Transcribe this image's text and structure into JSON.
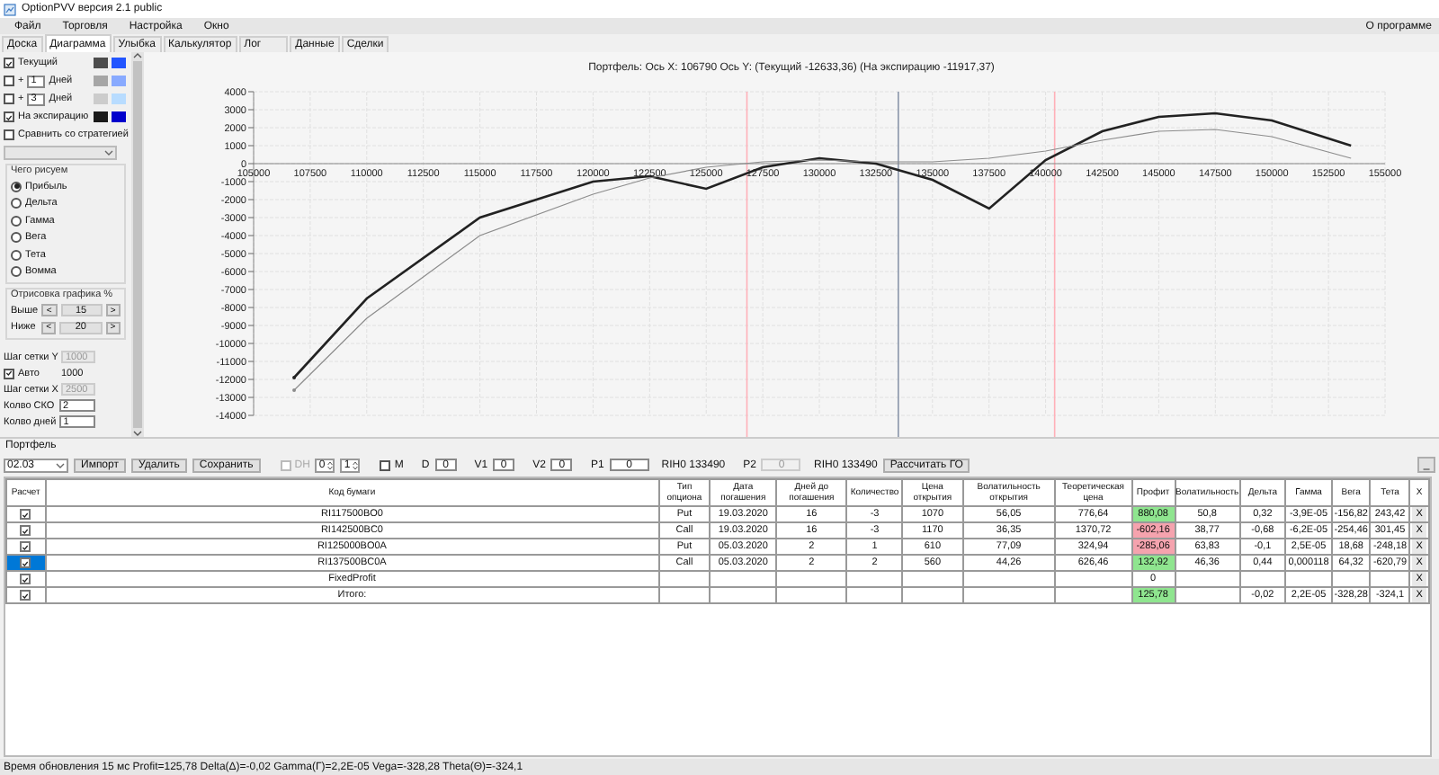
{
  "window": {
    "title": "OptionPVV версия 2.1 public"
  },
  "menu": {
    "items": [
      "Файл",
      "Торговля",
      "Настройка",
      "Окно"
    ],
    "right_item": "О программе"
  },
  "tabs": [
    {
      "label": "Доска",
      "selected": false
    },
    {
      "label": "Диаграмма",
      "selected": true
    },
    {
      "label": "Улыбка",
      "selected": false
    },
    {
      "label": "Калькулятор",
      "selected": false
    },
    {
      "label": "Лог",
      "selected": false
    },
    {
      "label": "Данные",
      "selected": false
    },
    {
      "label": "Сделки",
      "selected": false
    }
  ],
  "left_panel": {
    "curves": [
      {
        "label": "Текущий",
        "checked": true,
        "swatches": [
          {
            "color": "#4d4d4d"
          },
          {
            "color": "#2255ff"
          }
        ]
      },
      {
        "prefix": "+",
        "days": "1",
        "label": "Дней",
        "checked": false,
        "swatches": [
          {
            "color": "#a6a6a6"
          },
          {
            "color": "#88aaff"
          }
        ]
      },
      {
        "prefix": "+",
        "days": "3",
        "label": "Дней",
        "checked": false,
        "swatches": [
          {
            "color": "#cccccc"
          },
          {
            "color": "#b8dcff"
          }
        ]
      },
      {
        "label": "На экспирацию",
        "checked": true,
        "swatches": [
          {
            "color": "#1a1a1a"
          },
          {
            "color": "#0000cc"
          }
        ]
      }
    ],
    "compare": {
      "label": "Сравнить со стратегией",
      "checked": false
    },
    "draw_mode": {
      "title": "Чего рисуем",
      "options": [
        {
          "label": "Прибыль",
          "selected": true
        },
        {
          "label": "Дельта",
          "selected": false
        },
        {
          "label": "Гамма",
          "selected": false
        },
        {
          "label": "Вега",
          "selected": false
        },
        {
          "label": "Тета",
          "selected": false
        },
        {
          "label": "Вомма",
          "selected": false
        }
      ]
    },
    "range": {
      "title": "Отрисовка графика %",
      "rows": [
        {
          "label": "Выше",
          "dec": "<",
          "value": "15",
          "inc": ">"
        },
        {
          "label": "Ниже",
          "dec": "<",
          "value": "20",
          "inc": ">"
        }
      ]
    },
    "settings": [
      {
        "kind": "field",
        "label": "Шаг сетки Y",
        "value": "1000",
        "disabled": true
      },
      {
        "kind": "check",
        "label": "Авто",
        "checked": true,
        "value": "1000"
      },
      {
        "kind": "field",
        "label": "Шаг сетки X",
        "value": "2500",
        "disabled": true
      },
      {
        "kind": "field",
        "label": "Колво СКО",
        "value": "2",
        "disabled": false
      },
      {
        "kind": "field",
        "label": "Колво дней",
        "value": "1",
        "disabled": false
      }
    ]
  },
  "chart": {
    "title": "Портфель: Ось X: 106790 Ось Y: (Текущий -12633,36) (На экспирацию -11917,37)",
    "chart_data": {
      "type": "line",
      "xlim": [
        105000,
        155000
      ],
      "ylim": [
        -14000,
        4000
      ],
      "xticks": [
        105000,
        107500,
        110000,
        112500,
        115000,
        117500,
        120000,
        122500,
        125000,
        127500,
        130000,
        132500,
        135000,
        137500,
        140000,
        142500,
        145000,
        147500,
        150000,
        152500,
        155000
      ],
      "yticks": [
        4000,
        3000,
        2000,
        1000,
        0,
        -1000,
        -2000,
        -3000,
        -4000,
        -5000,
        -6000,
        -7000,
        -8000,
        -9000,
        -10000,
        -11000,
        -12000,
        -13000,
        -14000
      ],
      "x": [
        106790,
        110000,
        115000,
        120000,
        122500,
        125000,
        127500,
        130000,
        132500,
        135000,
        137500,
        140000,
        142500,
        145000,
        147500,
        150000,
        153500
      ],
      "series": [
        {
          "color": "#222222",
          "values": [
            -11900,
            -7500,
            -3000,
            -1000,
            -700,
            -1400,
            -200,
            300,
            0,
            -900,
            -2500,
            200,
            1800,
            2600,
            2800,
            2400,
            1000
          ]
        },
        {
          "color": "#8c8c8c",
          "values": [
            -12600,
            -8600,
            -4000,
            -1700,
            -800,
            -200,
            100,
            200,
            100,
            100,
            300,
            700,
            1300,
            1800,
            1900,
            1500,
            300
          ]
        }
      ],
      "grid": true,
      "ref_lines": [
        {
          "axis": "x",
          "value": 126800,
          "color": "#ffb0b8"
        },
        {
          "axis": "x",
          "value": 133490,
          "color": "#8a96aa"
        },
        {
          "axis": "x",
          "value": 140400,
          "color": "#ffb0b8"
        }
      ]
    }
  },
  "portfolio": {
    "label": "Портфель",
    "toolbar": [
      {
        "kind": "select",
        "value": "02.03"
      },
      {
        "kind": "button",
        "label": "Импорт"
      },
      {
        "kind": "button",
        "label": "Удалить"
      },
      {
        "kind": "button",
        "label": "Сохранить"
      },
      {
        "kind": "check",
        "label": "DH",
        "checked": false,
        "disabled": true
      },
      {
        "kind": "spin",
        "value": "0"
      },
      {
        "kind": "spin",
        "value": "1"
      },
      {
        "kind": "check",
        "label": "M",
        "checked": false,
        "disabled": false
      },
      {
        "kind": "field",
        "label": "D",
        "value": "0",
        "disabled": false
      },
      {
        "kind": "field",
        "label": "V1",
        "value": "0",
        "disabled": false
      },
      {
        "kind": "field",
        "label": "V2",
        "value": "0",
        "disabled": false
      },
      {
        "kind": "field",
        "label": "P1",
        "value": "0",
        "disabled": false
      },
      {
        "kind": "text",
        "label": "RIH0 133490"
      },
      {
        "kind": "field",
        "label": "P2",
        "value": "0",
        "disabled": true
      },
      {
        "kind": "text",
        "label": "RIH0 133490"
      },
      {
        "kind": "button",
        "label": "Рассчитать ГО"
      }
    ],
    "minimize": "_"
  },
  "table": {
    "columns": [
      "Расчет",
      "Код бумаги",
      "Тип опциона",
      "Дата погашения",
      "Дней до погашения",
      "Количество",
      "Цена открытия",
      "Волатильность открытия",
      "Теоретическая цена",
      "Профит",
      "Волатильность",
      "Дельта",
      "Гамма",
      "Вега",
      "Тета",
      "X"
    ],
    "rows": [
      {
        "checked": true,
        "selected": false,
        "code": "RI117500BO0",
        "type": "Put",
        "expiry": "19.03.2020",
        "days": "16",
        "qty": "-3",
        "open_price": "1070",
        "open_vol": "56,05",
        "theo_price": "776,64",
        "profit": {
          "value": "880,08",
          "color": "#8fe58f"
        },
        "vol": "50,8",
        "delta": "0,32",
        "gamma": "-3,9E-05",
        "vega": "-156,82",
        "theta": "243,42",
        "delete": "X"
      },
      {
        "checked": true,
        "selected": false,
        "code": "RI142500BC0",
        "type": "Call",
        "expiry": "19.03.2020",
        "days": "16",
        "qty": "-3",
        "open_price": "1170",
        "open_vol": "36,35",
        "theo_price": "1370,72",
        "profit": {
          "value": "-602,16",
          "color": "#f5a3ae"
        },
        "vol": "38,77",
        "delta": "-0,68",
        "gamma": "-6,2E-05",
        "vega": "-254,46",
        "theta": "301,45",
        "delete": "X"
      },
      {
        "checked": true,
        "selected": false,
        "code": "RI125000BO0A",
        "type": "Put",
        "expiry": "05.03.2020",
        "days": "2",
        "qty": "1",
        "open_price": "610",
        "open_vol": "77,09",
        "theo_price": "324,94",
        "profit": {
          "value": "-285,06",
          "color": "#f5a3ae"
        },
        "vol": "63,83",
        "delta": "-0,1",
        "gamma": "2,5E-05",
        "vega": "18,68",
        "theta": "-248,18",
        "delete": "X"
      },
      {
        "checked": true,
        "selected": true,
        "code": "RI137500BC0A",
        "type": "Call",
        "expiry": "05.03.2020",
        "days": "2",
        "qty": "2",
        "open_price": "560",
        "open_vol": "44,26",
        "theo_price": "626,46",
        "profit": {
          "value": "132,92",
          "color": "#8fe58f"
        },
        "vol": "46,36",
        "delta": "0,44",
        "gamma": "0,000118",
        "vega": "64,32",
        "theta": "-620,79",
        "delete": "X"
      },
      {
        "checked": true,
        "selected": false,
        "code": "FixedProfit",
        "profit": {
          "value": "0"
        },
        "delete": "X"
      },
      {
        "checked": true,
        "selected": false,
        "code": "Итого:",
        "profit": {
          "value": "125,78",
          "color": "#8fe58f"
        },
        "delta": "-0,02",
        "gamma": "2,2E-05",
        "vega": "-328,28",
        "theta": "-324,1",
        "delete": "X"
      }
    ]
  },
  "status_bar": "Время обновления 15 мс  Profit=125,78 Delta(Δ)=-0,02 Gamma(Γ)=2,2E-05 Vega=-328,28 Theta(Θ)=-324,1"
}
